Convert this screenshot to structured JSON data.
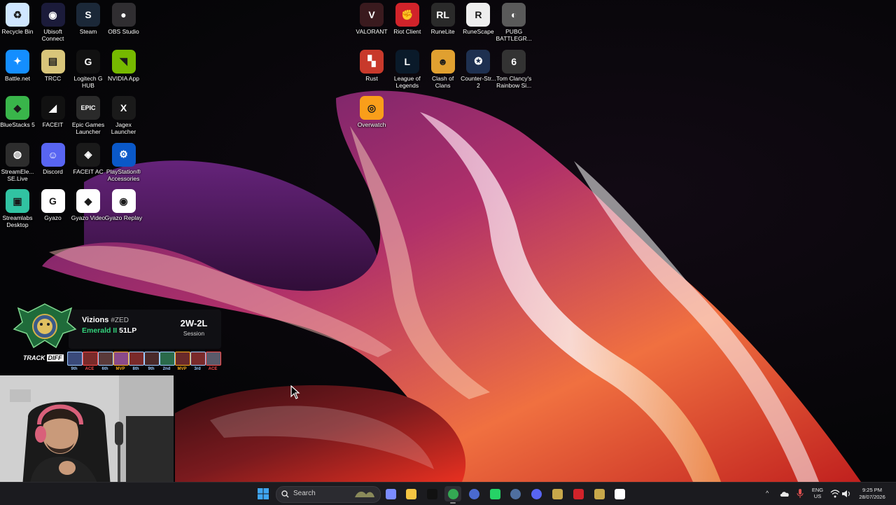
{
  "desktop": {
    "icons_left": [
      {
        "id": "recycle-bin",
        "label": "Recycle Bin",
        "color": "#cfe6ff",
        "glyph": "♻"
      },
      {
        "id": "ubisoft-connect",
        "label": "Ubisoft Connect",
        "color": "#1b1b3a",
        "glyph": "◉"
      },
      {
        "id": "steam",
        "label": "Steam",
        "color": "#1b2838",
        "glyph": "S"
      },
      {
        "id": "obs-studio",
        "label": "OBS Studio",
        "color": "#302e31",
        "glyph": "●"
      },
      {
        "id": "battle-net",
        "label": "Battle.net",
        "color": "#148eff",
        "glyph": "✦"
      },
      {
        "id": "trcc",
        "label": "TRCC",
        "color": "#d8c57a",
        "glyph": "▤"
      },
      {
        "id": "logitech-g-hub",
        "label": "Logitech G HUB",
        "color": "#111111",
        "glyph": "G"
      },
      {
        "id": "nvidia-app",
        "label": "NVIDIA App",
        "color": "#76b900",
        "glyph": "◥"
      },
      {
        "id": "bluestacks-5",
        "label": "BlueStacks 5",
        "color": "#39b54a",
        "glyph": "◆"
      },
      {
        "id": "faceit",
        "label": "FACEIT",
        "color": "#111111",
        "glyph": "◢"
      },
      {
        "id": "epic-games-launcher",
        "label": "Epic Games Launcher",
        "color": "#2a2a2a",
        "glyph": "EPIC"
      },
      {
        "id": "jagex-launcher",
        "label": "Jagex Launcher",
        "color": "#1a1a1a",
        "glyph": "X"
      },
      {
        "id": "streamelements-selive",
        "label": "StreamEle... SE.Live",
        "color": "#2d2d2d",
        "glyph": "◍"
      },
      {
        "id": "discord",
        "label": "Discord",
        "color": "#5865f2",
        "glyph": "☺"
      },
      {
        "id": "faceit-ac",
        "label": "FACEIT AC",
        "color": "#1a1a1a",
        "glyph": "◈"
      },
      {
        "id": "playstation-accessories",
        "label": "PlayStation® Accessories",
        "color": "#0a58c8",
        "glyph": "⚙"
      },
      {
        "id": "streamlabs-desktop",
        "label": "Streamlabs Desktop",
        "color": "#31c3a2",
        "glyph": "▣"
      },
      {
        "id": "gyazo",
        "label": "Gyazo",
        "color": "#ffffff",
        "glyph": "G"
      },
      {
        "id": "gyazo-video",
        "label": "Gyazo Video",
        "color": "#ffffff",
        "glyph": "◆"
      },
      {
        "id": "gyazo-replay",
        "label": "Gyazo Replay",
        "color": "#ffffff",
        "glyph": "◉"
      }
    ],
    "icons_right": [
      {
        "id": "valorant",
        "label": "VALORANT",
        "color": "#3a1a1e",
        "glyph": "V"
      },
      {
        "id": "riot-client",
        "label": "Riot Client",
        "color": "#d1232a",
        "glyph": "✊"
      },
      {
        "id": "runelite",
        "label": "RuneLite",
        "color": "#2a2a2a",
        "glyph": "RL"
      },
      {
        "id": "runescape",
        "label": "RuneScape",
        "color": "#eeeeee",
        "glyph": "R"
      },
      {
        "id": "pubg-battlegrounds",
        "label": "PUBG BATTLEGR...",
        "color": "#5a5a5a",
        "glyph": "◐"
      },
      {
        "id": "rust",
        "label": "Rust",
        "color": "#c8392b",
        "glyph": "▚"
      },
      {
        "id": "league-of-legends",
        "label": "League of Legends",
        "color": "#0a1a2a",
        "glyph": "L"
      },
      {
        "id": "clash-of-clans",
        "label": "Clash of Clans",
        "color": "#e0a030",
        "glyph": "☻"
      },
      {
        "id": "counter-strike-2",
        "label": "Counter-Str... 2",
        "color": "#1e3050",
        "glyph": "✪"
      },
      {
        "id": "rainbow-six",
        "label": "Tom Clancy's Rainbow Si...",
        "color": "#333333",
        "glyph": "6"
      },
      {
        "id": "overwatch",
        "label": "Overwatch",
        "color": "#f99e1a",
        "glyph": "◎"
      }
    ]
  },
  "overlay": {
    "summoner_name": "Vizions",
    "summoner_tag": "#ZED",
    "rank_tier": "Emerald II",
    "rank_lp": "51LP",
    "session_record": "2W-2L",
    "session_label": "Session",
    "brand_track": "TRACK",
    "brand_diff": "DIFF",
    "matches": [
      {
        "place": "9th",
        "color": "#9ecbff",
        "champ": "#3a4a7a"
      },
      {
        "place": "ACE",
        "color": "#ff4d4d",
        "champ": "#7a2a2a"
      },
      {
        "place": "6th",
        "color": "#9ecbff",
        "champ": "#5a3a3a"
      },
      {
        "place": "MVP",
        "color": "#ffb020",
        "champ": "#8a4a8a"
      },
      {
        "place": "8th",
        "color": "#9ecbff",
        "champ": "#7a2a2a"
      },
      {
        "place": "9th",
        "color": "#9ecbff",
        "champ": "#4a2a2a"
      },
      {
        "place": "2nd",
        "color": "#9ecbff",
        "champ": "#2a6a4a"
      },
      {
        "place": "MVP",
        "color": "#ffb020",
        "champ": "#6a2a2a"
      },
      {
        "place": "3rd",
        "color": "#9ecbff",
        "champ": "#7a2a2a"
      },
      {
        "place": "ACE",
        "color": "#ff4d4d",
        "champ": "#5a5a6a"
      }
    ]
  },
  "taskbar": {
    "search_label": "Search",
    "apps": [
      {
        "id": "copilot",
        "color": "#7b8cff"
      },
      {
        "id": "file-explorer",
        "color": "#f5c542"
      },
      {
        "id": "tiktok",
        "color": "#111111"
      },
      {
        "id": "chrome",
        "color": "#34a853",
        "active": true
      },
      {
        "id": "riot-vanguard",
        "color": "#4a6ad0"
      },
      {
        "id": "whatsapp",
        "color": "#25d366"
      },
      {
        "id": "steam",
        "color": "#4f6f9f"
      },
      {
        "id": "discord",
        "color": "#5865f2"
      },
      {
        "id": "league-of-legends",
        "color": "#c8a84a"
      },
      {
        "id": "riot-client",
        "color": "#d1232a"
      },
      {
        "id": "league-client",
        "color": "#c8a84a"
      },
      {
        "id": "obs",
        "color": "#ffffff"
      }
    ],
    "tray": {
      "lang_top": "ENG",
      "lang_bottom": "US",
      "time": "9:25 PM",
      "date": "28/07/2026"
    }
  }
}
